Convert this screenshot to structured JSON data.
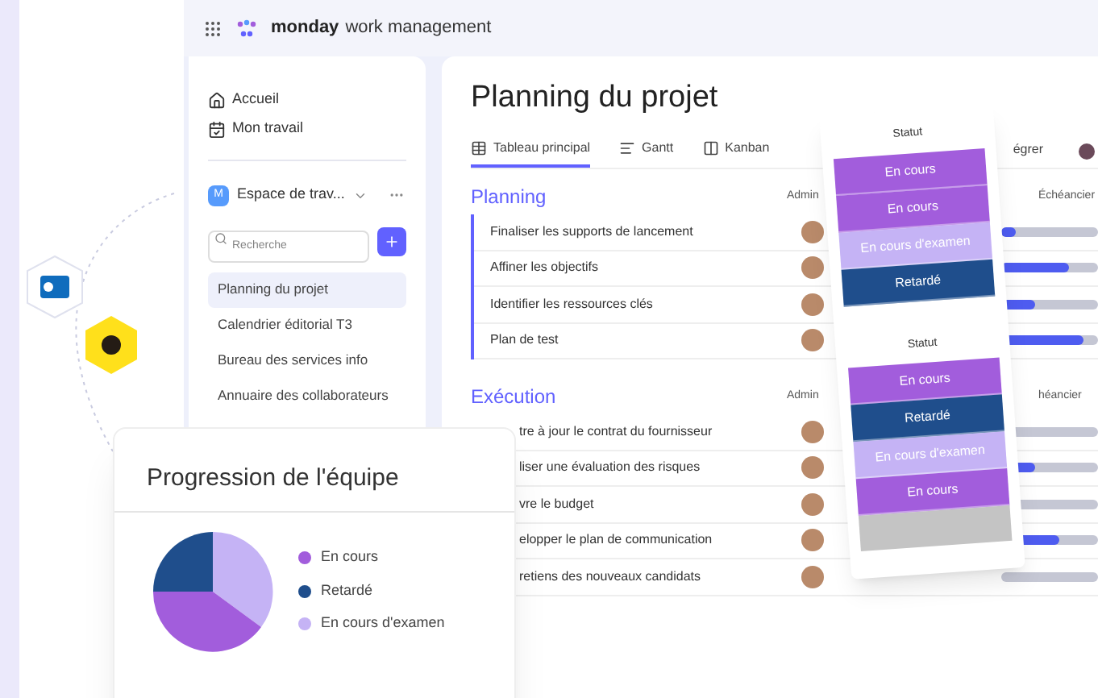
{
  "topbar": {
    "brand": "monday",
    "product": "work management"
  },
  "sidebar": {
    "nav": [
      {
        "label": "Accueil",
        "kind": "home"
      },
      {
        "label": "Mon travail",
        "kind": "work"
      }
    ],
    "workspace": {
      "badge": "M",
      "name": "Espace de trav..."
    },
    "search": {
      "placeholder": "Recherche"
    },
    "items": [
      {
        "label": "Planning du projet",
        "selected": true
      },
      {
        "label": "Calendrier éditorial T3",
        "selected": false
      },
      {
        "label": "Bureau des services info",
        "selected": false
      },
      {
        "label": "Annuaire des collaborateurs",
        "selected": false
      }
    ]
  },
  "board": {
    "title": "Planning du projet",
    "tabs": [
      {
        "label": "Tableau principal",
        "kind": "table",
        "selected": true
      },
      {
        "label": "Gantt",
        "kind": "gantt",
        "selected": false
      },
      {
        "label": "Kanban",
        "kind": "kanban",
        "selected": false
      }
    ],
    "integrate": "égrer",
    "groups": [
      {
        "name": "Planning",
        "admin": "Admin",
        "timeline": "Échéancier",
        "rows": [
          {
            "task": "Finaliser les supports de lancement",
            "level": 0.15
          },
          {
            "task": "Affiner les objectifs",
            "level": 0.7
          },
          {
            "task": "Identifier les ressources clés",
            "level": 0.35
          },
          {
            "task": "Plan de test",
            "level": 0.85
          }
        ]
      },
      {
        "name": "Exécution",
        "admin": "Admin",
        "timeline": "héancier",
        "rows": [
          {
            "task": "tre à jour le contrat du fournisseur",
            "level": 0
          },
          {
            "task": "liser une évaluation des risques",
            "level": 0.35
          },
          {
            "task": "vre le budget",
            "level": 0
          },
          {
            "task": "elopper le plan de communication",
            "level": 0.6
          },
          {
            "task": "retiens des nouveaux candidats",
            "level": 0
          }
        ]
      }
    ]
  },
  "status_popup": [
    {
      "title": "Statut",
      "items": [
        {
          "label": "En cours",
          "color": "#a25ddc"
        },
        {
          "label": "En cours",
          "color": "#a25ddc"
        },
        {
          "label": "En cours d'examen",
          "color": "#c5b3f5"
        },
        {
          "label": "Retardé",
          "color": "#1f4e8c"
        }
      ]
    },
    {
      "title": "Statut",
      "items": [
        {
          "label": "En cours",
          "color": "#a25ddc"
        },
        {
          "label": "Retardé",
          "color": "#1f4e8c"
        },
        {
          "label": "En cours d'examen",
          "color": "#c5b3f5"
        },
        {
          "label": "En cours",
          "color": "#a25ddc"
        }
      ]
    }
  ],
  "progress_card": {
    "title": "Progression de l'équipe",
    "legend": [
      {
        "label": "En cours",
        "color": "#a25ddc"
      },
      {
        "label": "Retardé",
        "color": "#1f4e8c"
      },
      {
        "label": "En cours d'examen",
        "color": "#c5b3f5"
      }
    ]
  }
}
